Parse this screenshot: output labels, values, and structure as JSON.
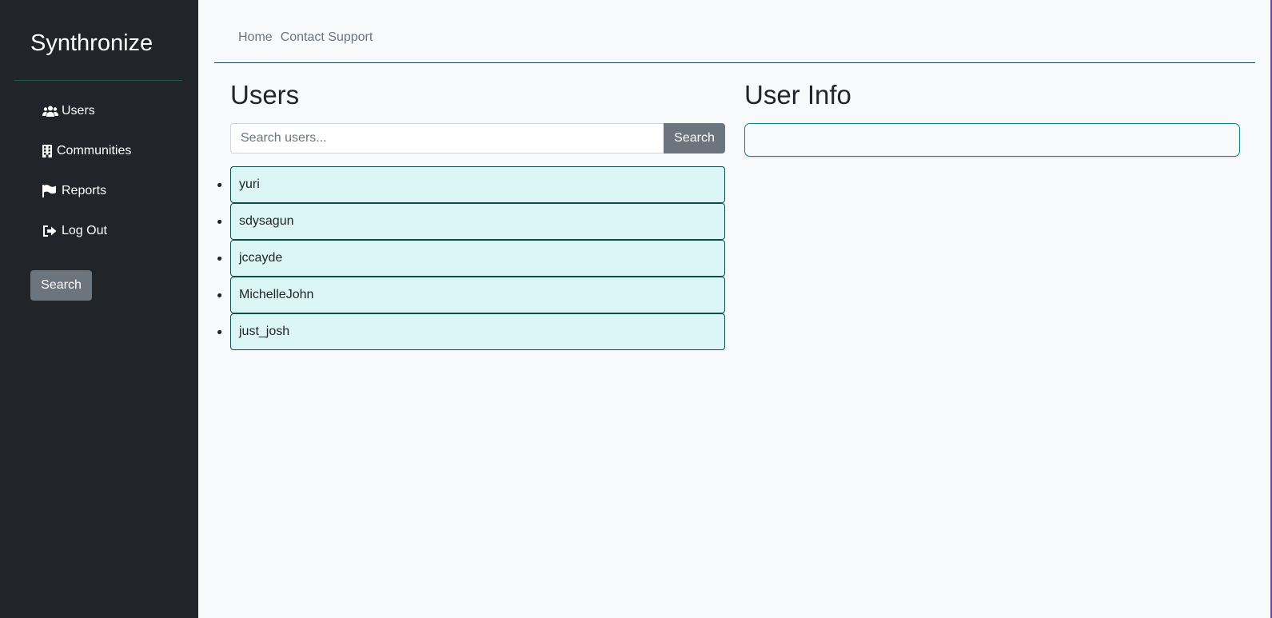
{
  "sidebar": {
    "brand": "Synthronize",
    "items": [
      {
        "label": "Users",
        "icon": "users-icon"
      },
      {
        "label": "Communities",
        "icon": "building-icon"
      },
      {
        "label": "Reports",
        "icon": "flag-icon"
      },
      {
        "label": "Log Out",
        "icon": "sign-out-icon"
      }
    ],
    "search_button": "Search"
  },
  "topnav": {
    "home": "Home",
    "contact": "Contact Support"
  },
  "users_panel": {
    "title": "Users",
    "search_placeholder": "Search users...",
    "search_button": "Search",
    "users": [
      "yuri",
      "sdysagun",
      "jccayde",
      "MichelleJohn",
      "just_josh"
    ]
  },
  "user_info": {
    "title": "User Info"
  },
  "colors": {
    "sidebar_bg": "#212529",
    "accent_teal": "#13867c",
    "user_item_bg": "#dcf6f8",
    "button_gray": "#6c757d"
  }
}
